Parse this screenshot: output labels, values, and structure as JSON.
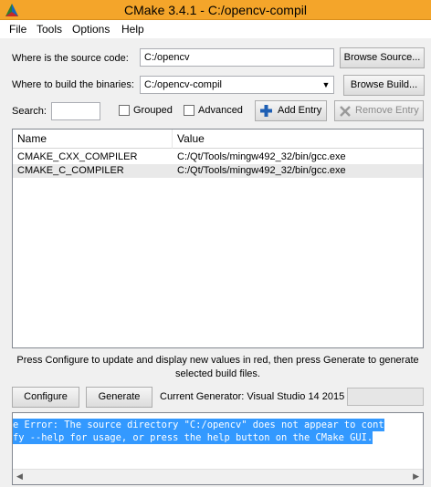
{
  "window": {
    "title": "CMake 3.4.1 - C:/opencv-compil"
  },
  "menu": {
    "items": [
      "File",
      "Tools",
      "Options",
      "Help"
    ]
  },
  "source": {
    "label": "Where is the source code:",
    "value": "C:/opencv",
    "browse_label": "Browse Source..."
  },
  "build": {
    "label": "Where to build the binaries:",
    "value": "C:/opencv-compil",
    "browse_label": "Browse Build..."
  },
  "toolbar": {
    "search_label": "Search:",
    "search_value": "",
    "grouped_label": "Grouped",
    "advanced_label": "Advanced",
    "add_entry_label": "Add Entry",
    "remove_entry_label": "Remove Entry"
  },
  "table": {
    "columns": [
      "Name",
      "Value"
    ],
    "rows": [
      {
        "name": "CMAKE_CXX_COMPILER",
        "value": "C:/Qt/Tools/mingw492_32/bin/gcc.exe"
      },
      {
        "name": "CMAKE_C_COMPILER",
        "value": "C:/Qt/Tools/mingw492_32/bin/gcc.exe"
      }
    ]
  },
  "hint": {
    "line1": "Press Configure to update and display new values in red, then press Generate to generate",
    "line2": "selected build files."
  },
  "actions": {
    "configure_label": "Configure",
    "generate_label": "Generate",
    "generator_text": "Current Generator: Visual Studio 14 2015"
  },
  "output": {
    "lines": [
      "e Error: The source directory \"C:/opencv\" does not appear to cont",
      "fy --help for usage, or press the help button on the CMake GUI."
    ]
  },
  "colors": {
    "title_bar": "#f4a52a",
    "selection": "#3399ff"
  },
  "icons": {
    "app": "cmake-triangle-icon",
    "add": "plus-icon",
    "remove": "x-icon",
    "combo": "chevron-down-icon"
  }
}
